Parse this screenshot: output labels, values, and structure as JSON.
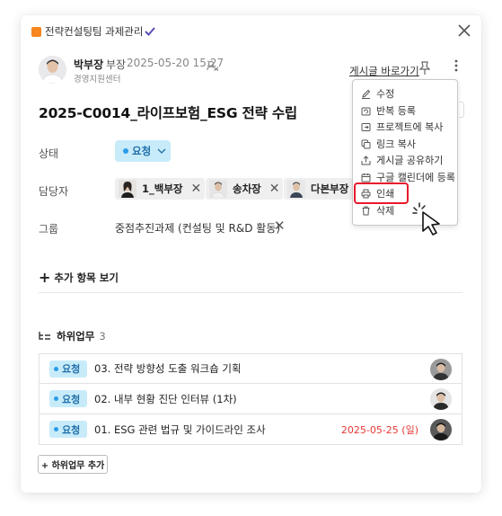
{
  "header": {
    "project": "전략컨설팅팀 과제관리",
    "close_icon": "close-icon"
  },
  "post": {
    "author_name": "박부장",
    "author_rank": "부장",
    "date": "2025-05-20 15:27",
    "org": "경영지원센터",
    "goto_label": "게시글 바로가기"
  },
  "task": {
    "title": "2025-C0014_라이프보험_ESG 전략 수립",
    "status_label": "상태",
    "status_value": "요청",
    "assignee_label": "담당자",
    "assignees": [
      "1_백부장",
      "송차장",
      "다본부장"
    ],
    "group_label": "그룹",
    "group_value": "중점추진과제 (컨설팅 및 R&D 활동)",
    "more_items": "추가 항목 보기"
  },
  "subtasks": {
    "heading": "하위업무",
    "count": "3",
    "items": [
      {
        "status": "요청",
        "name": "03. 전략 방향성 도출 워크숍 기획",
        "due": ""
      },
      {
        "status": "요청",
        "name": "02. 내부 현황 진단 인터뷰 (1차)",
        "due": ""
      },
      {
        "status": "요청",
        "name": "01. ESG 관련 법규 및 가이드라인 조사",
        "due": "2025-05-25 (일)"
      }
    ],
    "add_label": "+ 하위업무 추가"
  },
  "menu": {
    "items": [
      "수정",
      "반복 등록",
      "프로젝트에 복사",
      "링크 복사",
      "게시글 공유하기",
      "구글 캘린더에 등록",
      "인쇄",
      "삭제"
    ],
    "highlighted": "인쇄"
  },
  "colors": {
    "accent_orange": "#f7861f",
    "status_bg": "#c8ebfa",
    "status_text": "#1f6fa8",
    "due_red": "#e53935",
    "highlight_red": "#e8192c"
  }
}
